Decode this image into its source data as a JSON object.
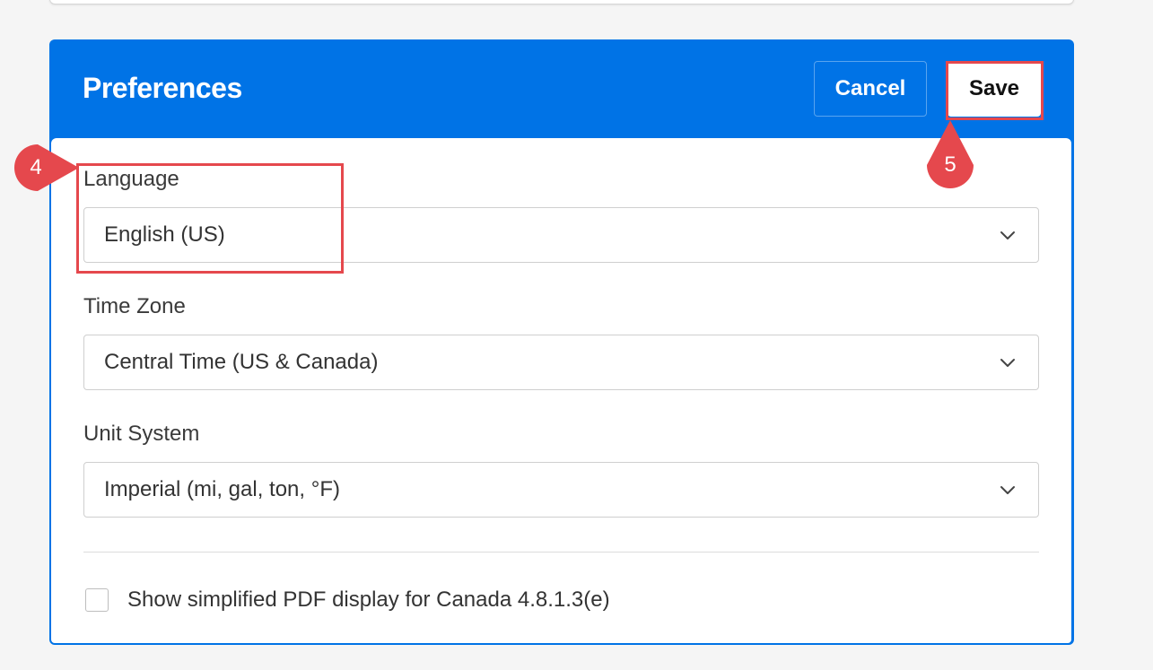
{
  "panel": {
    "title": "Preferences",
    "accent_color": "#0073e6",
    "cancel_label": "Cancel",
    "save_label": "Save"
  },
  "fields": {
    "language": {
      "label": "Language",
      "value": "English (US)"
    },
    "time_zone": {
      "label": "Time Zone",
      "value": "Central Time (US & Canada)"
    },
    "unit_system": {
      "label": "Unit System",
      "value": "Imperial (mi, gal, ton, °F)"
    }
  },
  "checkbox": {
    "label": "Show simplified PDF display for Canada 4.8.1.3(e)",
    "checked": false
  },
  "annotations": {
    "step_4": "4",
    "step_5": "5",
    "highlight_color": "#e5484d"
  },
  "icons": {
    "dropdown": "chevron-down-icon"
  }
}
